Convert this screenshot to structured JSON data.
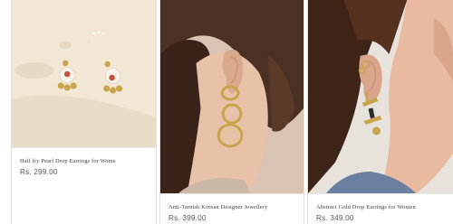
{
  "products": [
    {
      "name": "Half fry Pearl Drop Earrings for Wome",
      "price": "Rs. 299.00"
    },
    {
      "name": "Anti-Tarnish Korean Designer Jewellery",
      "price": "Rs. 399.00"
    },
    {
      "name": "Abstract Gold Drop Earrings for Women",
      "price": "Rs. 349.00"
    }
  ],
  "colors": {
    "background": "#ffffff",
    "card_border": "#e4e1dc",
    "name_text": "#3c3c3c",
    "price_text": "#555555",
    "gold": "#c9a44c"
  }
}
